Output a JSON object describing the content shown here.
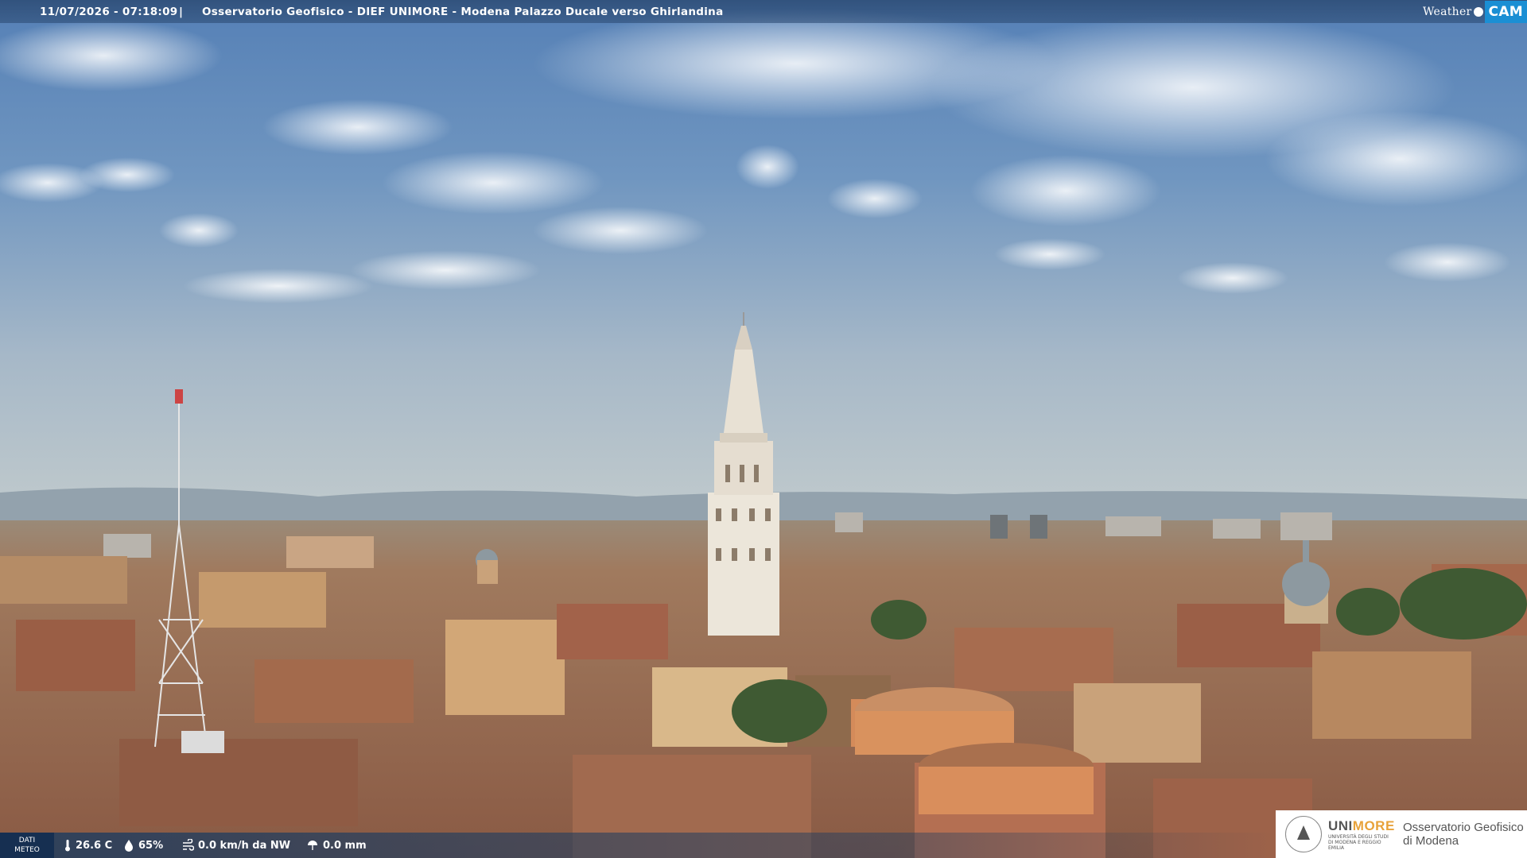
{
  "top_bar": {
    "datetime": "11/07/2026 - 07:18:09",
    "separator": "|",
    "title": "Osservatorio Geofisico - DIEF UNIMORE - Modena Palazzo Ducale verso Ghirlandina"
  },
  "weathercam_logo": {
    "word": "Weather",
    "cam": "CAM"
  },
  "weather_data": {
    "label_line1": "DATI",
    "label_line2": "METEO",
    "temperature": "26.6 C",
    "humidity": "65%",
    "wind": "0.0 km/h da NW",
    "rain": "0.0 mm",
    "icons": [
      "thermometer-icon",
      "humidity-drop-icon",
      "wind-icon",
      "rain-icon"
    ]
  },
  "badge": {
    "brand_a": "UNI",
    "brand_b": "MORE",
    "brand_sub": "UNIVERSITÀ DEGLI STUDI DI MODENA E REGGIO EMILIA",
    "observatory_line1": "Osservatorio Geofisico",
    "observatory_line2": "di Modena"
  },
  "colors": {
    "sky_top": "#5d86b8",
    "sky_horizon": "#b9c8cf",
    "roof": "#a86a4c",
    "tower": "#e9e2d6",
    "accent_cam": "#1b8fd4",
    "accent_more": "#e8a23a"
  }
}
